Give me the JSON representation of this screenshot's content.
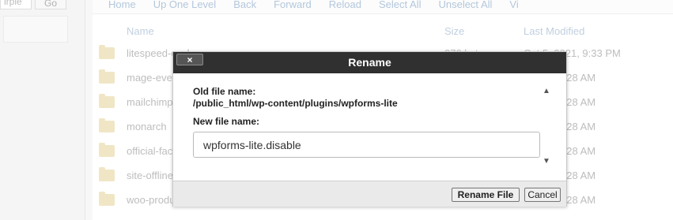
{
  "background": {
    "search_value": "irple",
    "go_label": "Go",
    "toolbar": [
      "Home",
      "Up One Level",
      "Back",
      "Forward",
      "Reload",
      "Select All",
      "Unselect All",
      "Vi"
    ],
    "columns": {
      "name": "Name",
      "size": "Size",
      "modified": "Last Modified"
    },
    "files": [
      {
        "name": "litespeed-cache",
        "size": "270 bytes",
        "modified": "Oct 5, 2021, 9:33 PM"
      },
      {
        "name": "mage-eventpress",
        "size": "",
        "modified": "2021, 10:28 AM"
      },
      {
        "name": "mailchimp",
        "size": "",
        "modified": "2021, 10:28 AM"
      },
      {
        "name": "monarch",
        "size": "",
        "modified": "2021, 10:28 AM"
      },
      {
        "name": "official-facebook",
        "size": "",
        "modified": "2021, 10:28 AM"
      },
      {
        "name": "site-offline",
        "size": "",
        "modified": "2021, 10:28 AM"
      },
      {
        "name": "woo-product",
        "size": "",
        "modified": "2021, 10:28 AM"
      }
    ]
  },
  "dialog": {
    "title": "Rename",
    "close_label": "×",
    "old_name_label": "Old file name:",
    "old_path": "/public_html/wp-content/plugins/wpforms-lite",
    "new_name_label": "New file name:",
    "new_name_value": "wpforms-lite.disable",
    "rename_button": "Rename File",
    "cancel_button": "Cancel"
  }
}
